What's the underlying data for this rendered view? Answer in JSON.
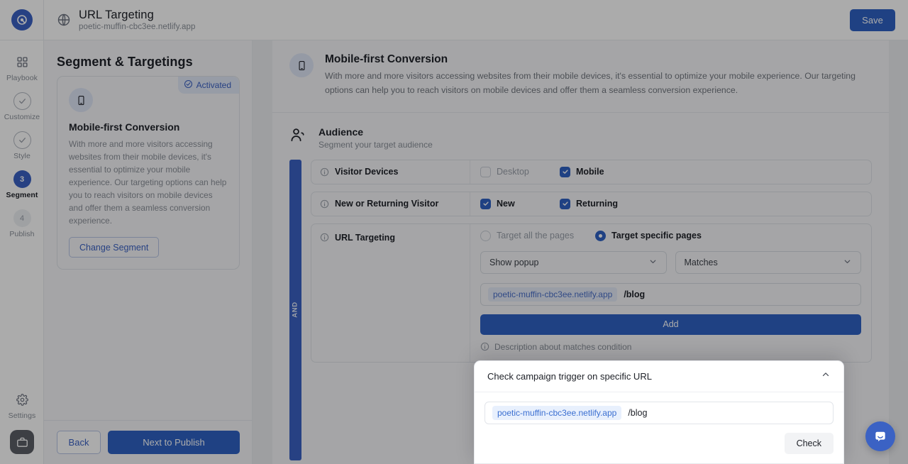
{
  "topbar": {
    "title": "URL Targeting",
    "subtitle": "poetic-muffin-cbc3ee.netlify.app",
    "save_label": "Save",
    "globe_icon": "globe-icon",
    "logo_icon": "brand-logo-icon"
  },
  "rail": {
    "items": [
      {
        "label": "Playbook",
        "state": "icon",
        "icon": "grid-icon",
        "badge": ""
      },
      {
        "label": "Customize",
        "state": "done",
        "icon": "check-circle-icon",
        "badge": ""
      },
      {
        "label": "Style",
        "state": "done",
        "icon": "check-circle-icon",
        "badge": ""
      },
      {
        "label": "Segment",
        "state": "active",
        "icon": "step-number",
        "badge": "3"
      },
      {
        "label": "Publish",
        "state": "pending",
        "icon": "step-number",
        "badge": "4"
      }
    ],
    "settings_label": "Settings",
    "settings_icon": "gear-icon",
    "briefcase_icon": "briefcase-icon"
  },
  "segment_panel": {
    "title": "Segment & Targetings",
    "card": {
      "badge_label": "Activated",
      "badge_icon": "check-circle-icon",
      "avatar_icon": "mobile-phone-icon",
      "title": "Mobile-first Conversion",
      "description": "With more and more visitors accessing websites from their mobile devices, it's essential to optimize your mobile experience. Our targeting options can help you to reach visitors on mobile devices and offer them a seamless conversion experience.",
      "change_label": "Change Segment"
    },
    "back_label": "Back",
    "next_label": "Next to Publish"
  },
  "main": {
    "hero": {
      "icon": "mobile-phone-icon",
      "title": "Mobile-first Conversion",
      "description": "With more and more visitors accessing websites from their mobile devices, it's essential to optimize your mobile experience. Our targeting options can help you to reach visitors on mobile devices and offer them a seamless conversion experience."
    },
    "audience": {
      "icon": "people-icon",
      "title": "Audience",
      "subtitle": "Segment your target audience",
      "and_label": "AND",
      "conditions": [
        {
          "name": "Visitor Devices",
          "info_icon": "info-icon",
          "control": "checkbox",
          "options": [
            {
              "label": "Desktop",
              "checked": false
            },
            {
              "label": "Mobile",
              "checked": true
            }
          ]
        },
        {
          "name": "New or Returning Visitor",
          "info_icon": "info-icon",
          "control": "checkbox",
          "options": [
            {
              "label": "New",
              "checked": true
            },
            {
              "label": "Returning",
              "checked": true
            }
          ]
        },
        {
          "name": "URL Targeting",
          "info_icon": "info-icon",
          "control": "radio",
          "options": [
            {
              "label": "Target all the pages",
              "checked": false
            },
            {
              "label": "Target specific pages",
              "checked": true
            }
          ],
          "action_select": "Show popup",
          "match_select": "Matches",
          "url_host": "poetic-muffin-cbc3ee.netlify.app",
          "url_path": "/blog",
          "add_label": "Add",
          "hint": "Description about matches condition",
          "hint_icon": "info-icon",
          "chevron_icon": "chevron-down-icon"
        }
      ]
    }
  },
  "check_modal": {
    "title": "Check campaign trigger on specific URL",
    "collapse_icon": "chevron-up-icon",
    "url_host": "poetic-muffin-cbc3ee.netlify.app",
    "url_path": "/blog",
    "check_label": "Check"
  },
  "chat": {
    "icon": "chat-bubble-icon"
  },
  "colors": {
    "accent": "#2f62c4",
    "accent_soft": "#dfe6f7",
    "panel": "#f6f7f9",
    "text": "#20232a",
    "muted": "#8a9099"
  }
}
